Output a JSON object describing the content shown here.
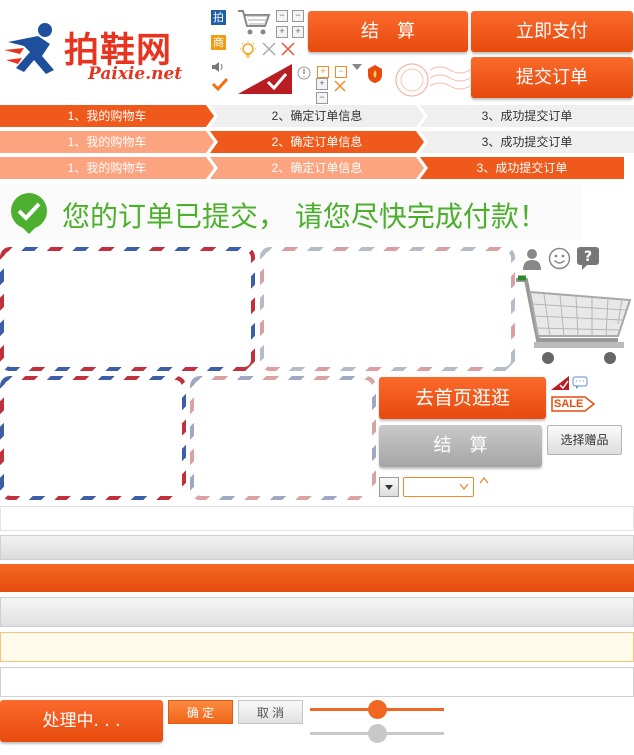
{
  "logo": {
    "cn": "拍鞋网",
    "en": "Paixie.net"
  },
  "header_icons": {
    "pai": "拍",
    "shang": "商"
  },
  "buttons": {
    "checkout": "结　算",
    "pay_now": "立即支付",
    "submit_order": "提交订单",
    "go_home": "去首页逛逛",
    "checkout_gray": "结　算",
    "choose_gift": "选择赠品",
    "processing": "处理中. . .",
    "confirm": "确 定",
    "cancel": "取 消"
  },
  "steps": [
    {
      "label": "1、我的购物车"
    },
    {
      "label": "2、确定订单信息"
    },
    {
      "label": "3、成功提交订单"
    }
  ],
  "message": "您的订单已提交， 请您尽快完成付款！",
  "badges": {
    "sale": "SALE"
  },
  "sliders": [
    {
      "value": 0.5
    },
    {
      "value": 0.5
    }
  ],
  "colors": {
    "accent": "#ef5a1c",
    "light_accent": "#fba47f",
    "success": "#4cb02e",
    "gray": "#efefef"
  },
  "icons": [
    "runner-logo-icon",
    "cart-icon",
    "lightbulb-icon",
    "close-x-icon",
    "check-icon",
    "volume-icon",
    "info-icon",
    "plus-icon",
    "minus-icon",
    "fire-badge-icon",
    "postmark-stamp-icon",
    "user-icon",
    "smile-icon",
    "question-icon",
    "shopping-cart-icon",
    "chat-icon",
    "sale-tag-icon"
  ]
}
